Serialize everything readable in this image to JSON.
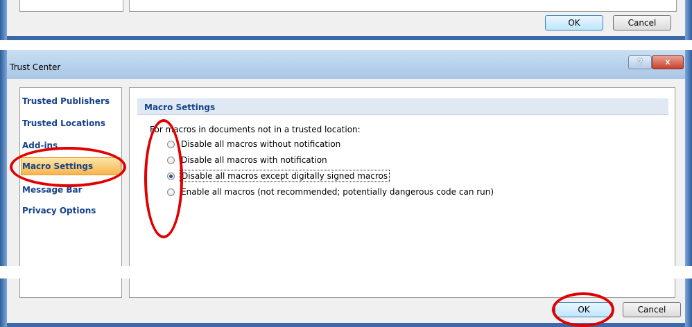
{
  "top_dialog": {
    "ok_label": "OK",
    "cancel_label": "Cancel"
  },
  "trust_center": {
    "title": "Trust Center",
    "help_button": "?",
    "close_button": "x",
    "nav": [
      {
        "label": "Trusted Publishers"
      },
      {
        "label": "Trusted Locations"
      },
      {
        "label": "Add-ins"
      },
      {
        "label": "Macro Settings",
        "selected": true
      },
      {
        "label": "Message Bar"
      },
      {
        "label": "Privacy Options"
      }
    ],
    "section_title": "Macro Settings",
    "intro": "For macros in documents not in a trusted location:",
    "options": [
      {
        "label": "Disable all macros without notification",
        "selected": false
      },
      {
        "label": "Disable all macros with notification",
        "selected": false
      },
      {
        "label": "Disable all macros except digitally signed macros",
        "selected": true
      },
      {
        "label": "Enable all macros (not recommended; potentially dangerous code can run)",
        "selected": false
      }
    ],
    "ok_label": "OK",
    "cancel_label": "Cancel"
  },
  "colors": {
    "annotation": "#e00000",
    "nav_selected": "#f7b44c",
    "nav_text": "#15428b",
    "section_header_bg": "#dfe8f3"
  }
}
